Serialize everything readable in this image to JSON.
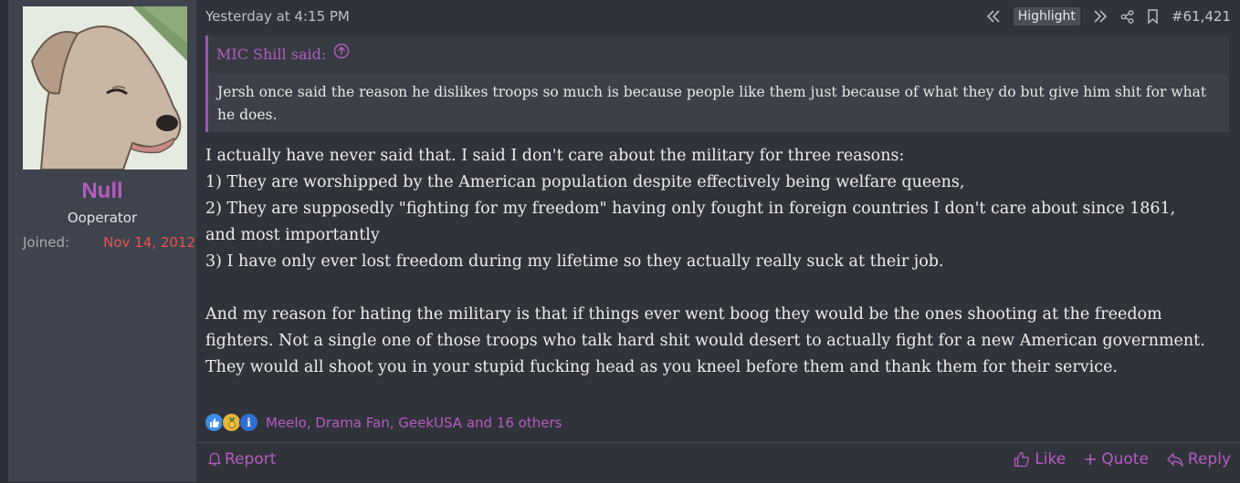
{
  "user": {
    "name": "Null",
    "title": "Ooperator",
    "joined_label": "Joined:",
    "joined_date": "Nov 14, 2012"
  },
  "post": {
    "timestamp": "Yesterday at 4:15 PM",
    "highlight_label": "Highlight",
    "post_number": "#61,421",
    "quote": {
      "author": "MIC Shill said:",
      "text": "Jersh once said the reason he dislikes troops so much is because people like them just because of what they do but give him shit for what he does."
    },
    "body": "I actually have never said that. I said I don't care about the military for three reasons:\n1) They are worshipped by the American population despite effectively being welfare queens,\n2) They are supposedly \"fighting for my freedom\" having only fought in foreign countries I don't care about since 1861,\nand most importantly\n3) I have only ever lost freedom during my lifetime so they actually really suck at their job.\n\nAnd my reason for hating the military is that if things ever went boog they would be the ones shooting at the freedom fighters. Not a single one of those troops who talk hard shit would desert to actually fight for a new American government. They would all shoot you in your stupid fucking head as you kneel before them and thank them for their service.",
    "reaction_icons": [
      "like-icon",
      "medal-icon",
      "info-icon"
    ],
    "reactions_text": "Meelo, Drama Fan, GeekUSA and 16 others"
  },
  "footer": {
    "report_label": "Report",
    "like_label": "Like",
    "quote_label": "Quote",
    "reply_label": "Reply"
  },
  "colors": {
    "accent": "#b55cc1",
    "joined_date": "#e8554e",
    "sidebar_bg": "#3e434d",
    "post_bg": "#30333a"
  }
}
